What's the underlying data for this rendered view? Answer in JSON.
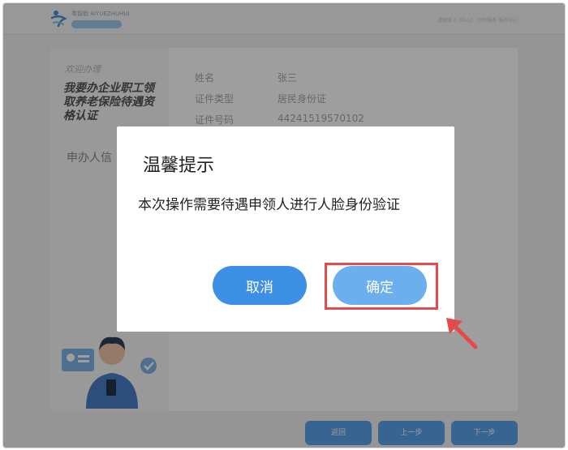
{
  "header": {
    "logo_text": "粤智助 AIYUEZHUHUI",
    "logo_badge": "· · · · · ·",
    "right_text": "请联系人 (中心) · 为你服务 服务中心"
  },
  "sidebar": {
    "welcome": "欢迎办理",
    "service_title": "我要办企业职工领取养老保险待遇资格认证",
    "applicant_label": "申办人信"
  },
  "info": {
    "rows": [
      {
        "label": "姓名",
        "value": "张三"
      },
      {
        "label": "证件类型",
        "value": "居民身份证"
      },
      {
        "label": "证件号码",
        "value": "44241519570102"
      }
    ]
  },
  "footer_buttons": {
    "back": "返回",
    "prev": "上一步",
    "next": "下一步"
  },
  "modal": {
    "title": "温馨提示",
    "message": "本次操作需要待遇申领人进行人脸身份验证",
    "cancel_label": "取消",
    "confirm_label": "确定"
  },
  "colors": {
    "primary": "#3d8fe5",
    "confirm": "#6cafee",
    "highlight": "#e34b4b"
  }
}
